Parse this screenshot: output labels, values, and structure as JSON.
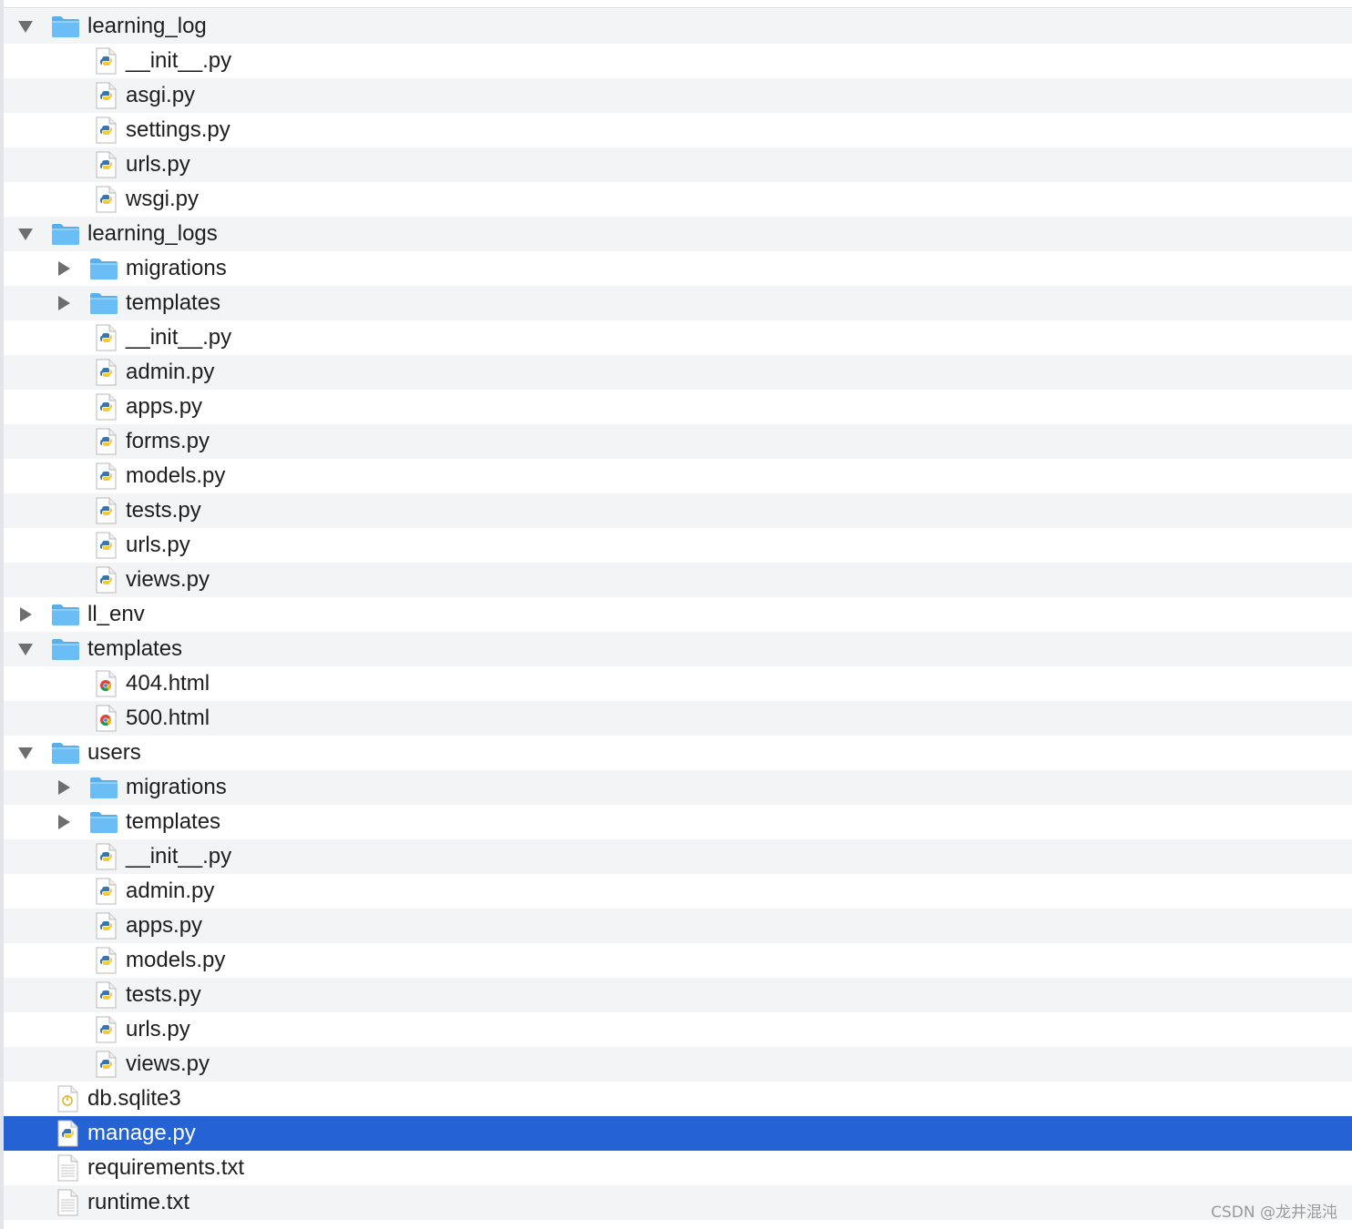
{
  "colors": {
    "row_alt": "#f3f4f5",
    "row_plain": "#ffffff",
    "selection": "#2563d5",
    "folder": "#6bbdf5",
    "text": "#1e1e1e",
    "disclosure": "#6e6e6e"
  },
  "tree": {
    "rows": [
      {
        "label": "learning_log",
        "depth": 0,
        "type": "folder",
        "expanded": true,
        "icon": "folder-icon"
      },
      {
        "label": "__init__.py",
        "depth": 1,
        "type": "python-file",
        "icon": "python-file-icon"
      },
      {
        "label": "asgi.py",
        "depth": 1,
        "type": "python-file",
        "icon": "python-file-icon"
      },
      {
        "label": "settings.py",
        "depth": 1,
        "type": "python-file",
        "icon": "python-file-icon"
      },
      {
        "label": "urls.py",
        "depth": 1,
        "type": "python-file",
        "icon": "python-file-icon"
      },
      {
        "label": "wsgi.py",
        "depth": 1,
        "type": "python-file",
        "icon": "python-file-icon"
      },
      {
        "label": "learning_logs",
        "depth": 0,
        "type": "folder",
        "expanded": true,
        "icon": "folder-icon"
      },
      {
        "label": "migrations",
        "depth": 1,
        "type": "folder",
        "expanded": false,
        "icon": "folder-icon"
      },
      {
        "label": "templates",
        "depth": 1,
        "type": "folder",
        "expanded": false,
        "icon": "folder-icon"
      },
      {
        "label": "__init__.py",
        "depth": 1,
        "type": "python-file",
        "icon": "python-file-icon"
      },
      {
        "label": "admin.py",
        "depth": 1,
        "type": "python-file",
        "icon": "python-file-icon"
      },
      {
        "label": "apps.py",
        "depth": 1,
        "type": "python-file",
        "icon": "python-file-icon"
      },
      {
        "label": "forms.py",
        "depth": 1,
        "type": "python-file",
        "icon": "python-file-icon"
      },
      {
        "label": "models.py",
        "depth": 1,
        "type": "python-file",
        "icon": "python-file-icon"
      },
      {
        "label": "tests.py",
        "depth": 1,
        "type": "python-file",
        "icon": "python-file-icon"
      },
      {
        "label": "urls.py",
        "depth": 1,
        "type": "python-file",
        "icon": "python-file-icon"
      },
      {
        "label": "views.py",
        "depth": 1,
        "type": "python-file",
        "icon": "python-file-icon"
      },
      {
        "label": "ll_env",
        "depth": 0,
        "type": "folder",
        "expanded": false,
        "icon": "folder-icon"
      },
      {
        "label": "templates",
        "depth": 0,
        "type": "folder",
        "expanded": true,
        "icon": "folder-icon"
      },
      {
        "label": "404.html",
        "depth": 1,
        "type": "html-file",
        "icon": "chrome-html-file-icon"
      },
      {
        "label": "500.html",
        "depth": 1,
        "type": "html-file",
        "icon": "chrome-html-file-icon"
      },
      {
        "label": "users",
        "depth": 0,
        "type": "folder",
        "expanded": true,
        "icon": "folder-icon"
      },
      {
        "label": "migrations",
        "depth": 1,
        "type": "folder",
        "expanded": false,
        "icon": "folder-icon"
      },
      {
        "label": "templates",
        "depth": 1,
        "type": "folder",
        "expanded": false,
        "icon": "folder-icon"
      },
      {
        "label": "__init__.py",
        "depth": 1,
        "type": "python-file",
        "icon": "python-file-icon"
      },
      {
        "label": "admin.py",
        "depth": 1,
        "type": "python-file",
        "icon": "python-file-icon"
      },
      {
        "label": "apps.py",
        "depth": 1,
        "type": "python-file",
        "icon": "python-file-icon"
      },
      {
        "label": "models.py",
        "depth": 1,
        "type": "python-file",
        "icon": "python-file-icon"
      },
      {
        "label": "tests.py",
        "depth": 1,
        "type": "python-file",
        "icon": "python-file-icon"
      },
      {
        "label": "urls.py",
        "depth": 1,
        "type": "python-file",
        "icon": "python-file-icon"
      },
      {
        "label": "views.py",
        "depth": 1,
        "type": "python-file",
        "icon": "python-file-icon"
      },
      {
        "label": "db.sqlite3",
        "depth": 0,
        "type": "db-file",
        "icon": "database-file-icon"
      },
      {
        "label": "manage.py",
        "depth": 0,
        "type": "python-file",
        "icon": "python-file-icon",
        "selected": true
      },
      {
        "label": "requirements.txt",
        "depth": 0,
        "type": "text-file",
        "icon": "text-file-icon"
      },
      {
        "label": "runtime.txt",
        "depth": 0,
        "type": "text-file",
        "icon": "text-file-icon"
      }
    ]
  },
  "watermark": {
    "text": "CSDN @龙井混沌"
  }
}
